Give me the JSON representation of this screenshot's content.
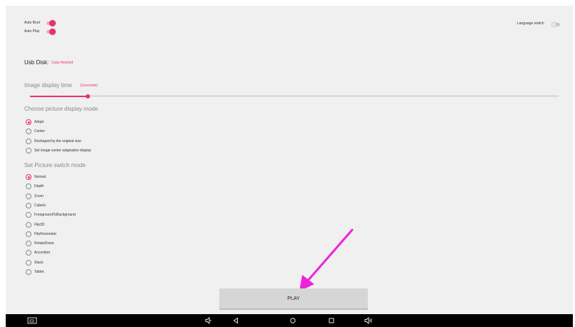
{
  "settings": {
    "auto_boot_label": "Auto Boot",
    "auto_boot_on": true,
    "auto_play_label": "Auto Play",
    "auto_play_on": true,
    "language_switch_label": "Language switch",
    "language_switch_on": false
  },
  "usb": {
    "label": "Usb Disk:",
    "status": "Copy finished"
  },
  "display_time": {
    "label": "Image display time",
    "value_text": "(2seconds)",
    "slider_value": 2,
    "slider_fraction": 0.11
  },
  "display_mode": {
    "heading": "Choose picture display mode",
    "options": [
      "Adapt",
      "Center",
      "Reshaped by the original size",
      "Set image center adaptation display"
    ],
    "selected": "Adapt"
  },
  "switch_mode": {
    "heading": "Set Picture switch mode",
    "options": [
      "Normal",
      "Depth",
      "Zoom",
      "CubeIn",
      "ForegroundToBackground",
      "Flip3D",
      "FlipHorizontal",
      "RotateDown",
      "Accordion",
      "Stack",
      "Tablet"
    ],
    "selected": "Normal"
  },
  "play_button": "PLAY",
  "colors": {
    "accent": "#e8336a",
    "annotation_arrow": "#ee22dd",
    "background": "#f0f0f0"
  },
  "navbar_icons": [
    "screenshot-icon",
    "volume-down-icon",
    "back-icon",
    "home-icon",
    "recents-icon",
    "volume-up-icon"
  ]
}
